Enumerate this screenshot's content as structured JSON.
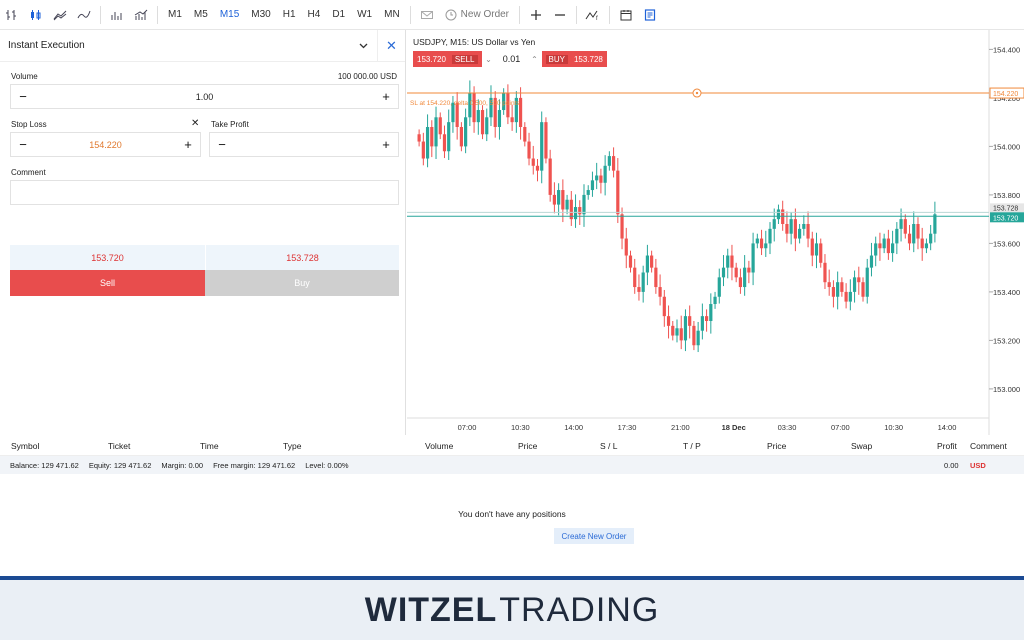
{
  "toolbar": {
    "timeframes": [
      "M1",
      "M5",
      "M15",
      "M30",
      "H1",
      "H4",
      "D1",
      "W1",
      "MN"
    ],
    "active_timeframe": "M15",
    "new_order_label": "New Order"
  },
  "order_panel": {
    "title": "Instant Execution",
    "volume_label": "Volume",
    "volume_units": "100 000.00 USD",
    "volume_value": "1.00",
    "stop_loss_label": "Stop Loss",
    "stop_loss_value": "154.220",
    "take_profit_label": "Take Profit",
    "take_profit_value": "",
    "comment_label": "Comment",
    "comment_value": "",
    "bid": "153.720",
    "ask": "153.728",
    "sell_label": "Sell",
    "buy_label": "Buy"
  },
  "chart": {
    "title": "USDJPY, M15: US Dollar vs Yen",
    "sell_price": "153.720",
    "sell_label": "SELL",
    "lot": "0.01",
    "buy_label": "BUY",
    "buy_price": "153.728",
    "sl_note": "SL at 154.220, delta 0.500, 500 points",
    "sl_tag": "154.220",
    "ask_tag": "153.728",
    "bid_tag": "153.720"
  },
  "chart_data": {
    "type": "candlestick",
    "title": "USDJPY, M15: US Dollar vs Yen",
    "y_ticks": [
      "154.400",
      "154.200",
      "154.000",
      "153.800",
      "153.600",
      "153.400",
      "153.200",
      "153.000"
    ],
    "ylim": [
      152.88,
      154.48
    ],
    "x_ticks": [
      "07:00",
      "10:30",
      "14:00",
      "17:30",
      "21:00",
      "18 Dec",
      "03:30",
      "07:00",
      "10:30",
      "14:00"
    ],
    "stop_loss": 154.22,
    "ask": 153.728,
    "bid": 153.72,
    "closes": [
      154.02,
      153.95,
      154.08,
      154.0,
      154.12,
      154.05,
      153.98,
      154.1,
      154.18,
      154.08,
      154.0,
      154.12,
      154.22,
      154.1,
      154.15,
      154.05,
      154.12,
      154.2,
      154.08,
      154.15,
      154.22,
      154.12,
      154.1,
      154.2,
      154.08,
      154.02,
      153.95,
      153.92,
      153.9,
      154.1,
      153.95,
      153.8,
      153.76,
      153.82,
      153.74,
      153.78,
      153.7,
      153.75,
      153.72,
      153.8,
      153.82,
      153.86,
      153.88,
      153.85,
      153.92,
      153.96,
      153.9,
      153.72,
      153.62,
      153.55,
      153.5,
      153.42,
      153.4,
      153.48,
      153.55,
      153.5,
      153.42,
      153.38,
      153.3,
      153.26,
      153.22,
      153.25,
      153.2,
      153.3,
      153.26,
      153.18,
      153.24,
      153.3,
      153.28,
      153.35,
      153.38,
      153.46,
      153.5,
      153.55,
      153.5,
      153.46,
      153.42,
      153.5,
      153.48,
      153.6,
      153.62,
      153.58,
      153.6,
      153.66,
      153.7,
      153.74,
      153.68,
      153.64,
      153.7,
      153.62,
      153.66,
      153.68,
      153.62,
      153.55,
      153.6,
      153.52,
      153.44,
      153.42,
      153.38,
      153.44,
      153.4,
      153.36,
      153.4,
      153.46,
      153.44,
      153.38,
      153.5,
      153.55,
      153.6,
      153.58,
      153.62,
      153.56,
      153.6,
      153.66,
      153.7,
      153.64,
      153.6,
      153.68,
      153.62,
      153.58,
      153.6,
      153.64,
      153.72
    ]
  },
  "positions": {
    "columns": [
      "Symbol",
      "Ticket",
      "Time",
      "Type",
      "Volume",
      "Price",
      "S / L",
      "T / P",
      "Price",
      "Swap",
      "Profit",
      "Comment"
    ],
    "balance": "Balance: 129 471.62",
    "equity": "Equity: 129 471.62",
    "margin": "Margin: 0.00",
    "free_margin": "Free margin: 129 471.62",
    "level": "Level: 0.00%",
    "profit_total": "0.00",
    "currency": "USD",
    "empty_message": "You don't have any positions",
    "create_label": "Create New Order"
  },
  "footer": {
    "brand_bold": "WITZEL",
    "brand_light": "TRADING"
  },
  "colors": {
    "accent": "#1e62d8",
    "sell": "#e84d4d",
    "buy_disabled": "#cfcfcf",
    "up": "#26a69a",
    "down": "#ef5350",
    "sl_line": "#f0883a"
  }
}
